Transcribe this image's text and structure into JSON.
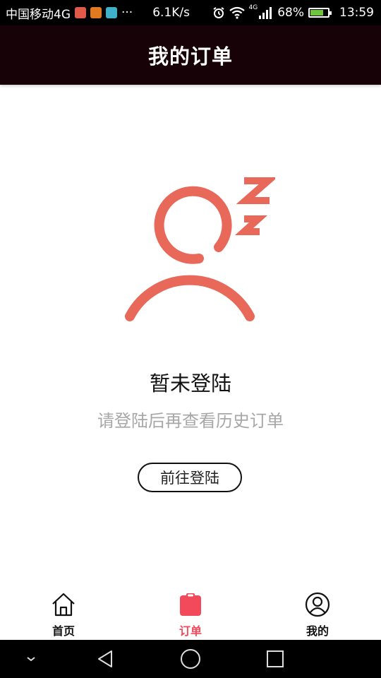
{
  "status_bar": {
    "carrier": "中国移动4G",
    "more": "···",
    "speed": "6.1K/s",
    "network": "4G",
    "battery": "68%",
    "battery_level": 0.68,
    "time": "13:59"
  },
  "header": {
    "title": "我的订单"
  },
  "empty_state": {
    "title": "暂未登陆",
    "subtitle": "请登陆后再查看历史订单",
    "button_label": "前往登陆",
    "illustration_color": "#e8685a"
  },
  "tab_bar": {
    "items": [
      {
        "label": "首页",
        "icon": "home-icon",
        "active": false
      },
      {
        "label": "订单",
        "icon": "clipboard-icon",
        "active": true
      },
      {
        "label": "我的",
        "icon": "user-circle-icon",
        "active": false
      }
    ],
    "active_color": "#f24a5a"
  },
  "colors": {
    "app_bar": "#170207",
    "accent": "#f24a5a"
  }
}
